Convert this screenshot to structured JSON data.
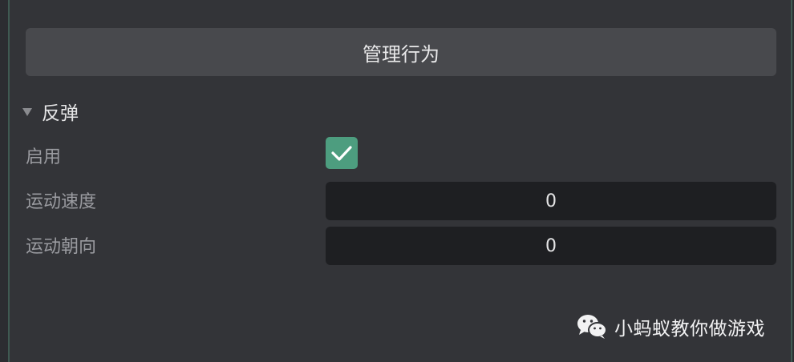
{
  "panel": {
    "manage_button_label": "管理行为"
  },
  "section": {
    "title": "反弹",
    "expanded": true
  },
  "properties": {
    "enabled": {
      "label": "启用",
      "checked": true
    },
    "move_speed": {
      "label": "运动速度",
      "value": "0"
    },
    "move_direction": {
      "label": "运动朝向",
      "value": "0"
    }
  },
  "watermark": {
    "icon": "wechat-icon",
    "text": "小蚂蚁教你做游戏"
  },
  "colors": {
    "accent": "#4d9d7f",
    "background": "#333438",
    "field": "#1e1f22"
  }
}
